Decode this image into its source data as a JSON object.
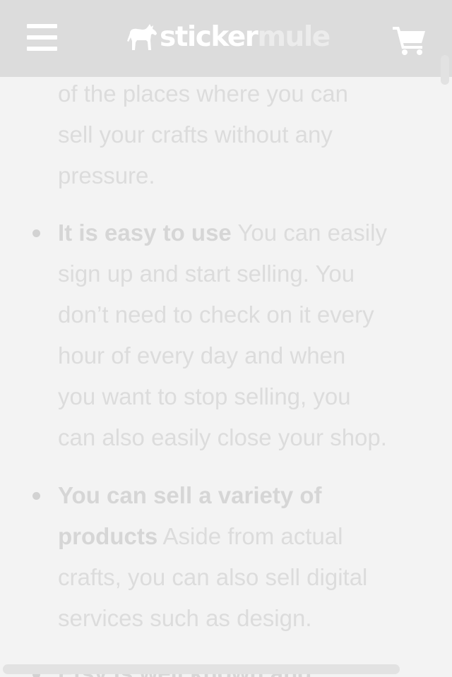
{
  "header": {
    "logo_word1": "sticker",
    "logo_word2": "mule",
    "menu_icon": "hamburger-menu-icon",
    "cart_icon": "shopping-cart-icon"
  },
  "article": {
    "intro_lines": [
      "of the places where you can",
      "sell your crafts without any",
      "pressure."
    ],
    "items": [
      {
        "bold": "It is easy to use",
        "lines_rest": [
          " You can easily",
          "sign up and start selling. You",
          "don’t need to check on it every",
          "hour of every day and when",
          "you want to stop selling, you",
          "can also easily close your shop."
        ]
      },
      {
        "bold_line1": "You can sell a variety of",
        "bold_line2": "products",
        "lines_rest": [
          " Aside from actual",
          "crafts, you can also sell digital",
          "services such as design."
        ]
      },
      {
        "bold": "Etsy is well known and"
      }
    ]
  },
  "colors": {
    "header_bg": "#dcdcdc",
    "page_bg": "#f3f3f3",
    "text": "#dcdcdc",
    "icon": "#ffffff"
  }
}
